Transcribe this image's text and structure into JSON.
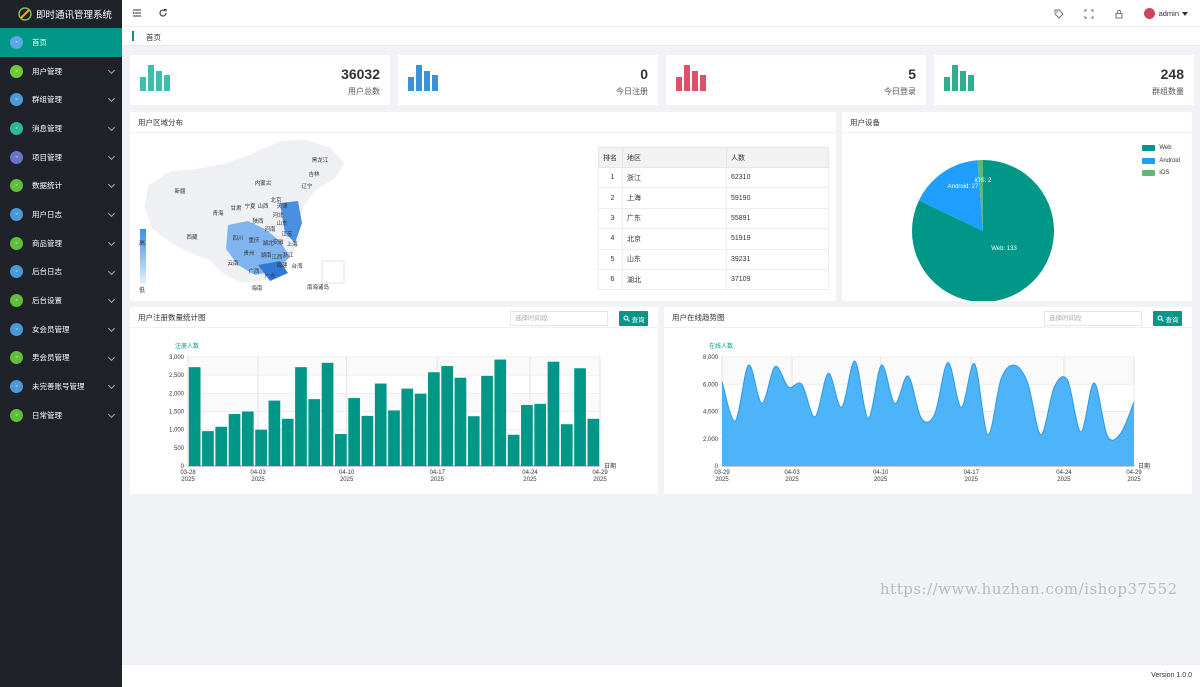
{
  "app": {
    "title": "即时通讯管理系统"
  },
  "sidebar": {
    "items": [
      {
        "label": "首页",
        "color": "#5aa9e6",
        "active": true
      },
      {
        "label": "用户管理",
        "color": "#6fca3b"
      },
      {
        "label": "群组管理",
        "color": "#4a9ad9"
      },
      {
        "label": "消息管理",
        "color": "#2fb59a"
      },
      {
        "label": "项目管理",
        "color": "#6c74c9"
      },
      {
        "label": "数据统计",
        "color": "#5fbf3a"
      },
      {
        "label": "用户日志",
        "color": "#4a9ad9"
      },
      {
        "label": "商品管理",
        "color": "#5fbf3a"
      },
      {
        "label": "后台日志",
        "color": "#4a9ad9"
      },
      {
        "label": "后台设置",
        "color": "#5fbf3a"
      },
      {
        "label": "女会员管理",
        "color": "#4a9ad9"
      },
      {
        "label": "男会员管理",
        "color": "#5fbf3a"
      },
      {
        "label": "未完善账号管理",
        "color": "#4a9ad9"
      },
      {
        "label": "日常管理",
        "color": "#5fbf3a"
      }
    ]
  },
  "topbar": {
    "user": "admin"
  },
  "breadcrumb": {
    "home": "首页"
  },
  "stats": [
    {
      "value": "36032",
      "label": "用户总数",
      "color": "#3dbfb0"
    },
    {
      "value": "0",
      "label": "今日注册",
      "color": "#3a92dd"
    },
    {
      "value": "5",
      "label": "今日登录",
      "color": "#e0506b"
    },
    {
      "value": "248",
      "label": "群组数量",
      "color": "#30b08f"
    }
  ],
  "region": {
    "title": "用户区域分布",
    "legend_high": "高",
    "legend_low": "低",
    "table_headers": [
      "排名",
      "地区",
      "人数"
    ],
    "rows": [
      [
        "1",
        "浙江",
        "62310"
      ],
      [
        "2",
        "上海",
        "59190"
      ],
      [
        "3",
        "广东",
        "55891"
      ],
      [
        "4",
        "北京",
        "51919"
      ],
      [
        "5",
        "山东",
        "39231"
      ],
      [
        "6",
        "湖北",
        "37109"
      ]
    ],
    "map_labels": [
      "黑龙江",
      "吉林",
      "辽宁",
      "内蒙古",
      "新疆",
      "青海",
      "甘肃",
      "宁夏",
      "山西",
      "北京",
      "天津",
      "河北",
      "山东",
      "陕西",
      "河南",
      "江苏",
      "安徽",
      "四川",
      "重庆",
      "湖北",
      "上海",
      "浙江",
      "西藏",
      "贵州",
      "湖南",
      "江西",
      "云南",
      "广西",
      "广东",
      "福建",
      "台湾",
      "海南",
      "南海诸岛"
    ]
  },
  "device": {
    "title": "用户设备",
    "slices": [
      {
        "name": "Web",
        "value": 133,
        "color": "#009688",
        "label": "Web: 133"
      },
      {
        "name": "Android",
        "value": 27,
        "color": "#1e9fff",
        "label": "Android: 27"
      },
      {
        "name": "iOS",
        "value": 2,
        "color": "#5fb878",
        "label": "iOS: 2"
      }
    ]
  },
  "register_chart": {
    "title": "用户注册数量统计图",
    "placeholder": "选择时间段",
    "query": "查询"
  },
  "online_chart": {
    "title": "用户在线趋势图",
    "placeholder": "选择时间段",
    "query": "查询"
  },
  "chart_data": [
    {
      "type": "bar",
      "ylabel": "注册人数",
      "xlabel": "日期",
      "ylim": [
        0,
        3000
      ],
      "yticks": [
        "3,000",
        "2,500",
        "2,000",
        "1,500",
        "1,000",
        "500",
        "0"
      ],
      "xticks": [
        [
          "03-28",
          "2025"
        ],
        [
          "04-03",
          "2025"
        ],
        [
          "04-10",
          "2025"
        ],
        [
          "04-17",
          "2025"
        ],
        [
          "04-24",
          "2025"
        ],
        [
          "04-29",
          "2025"
        ]
      ],
      "values": [
        2720,
        960,
        1080,
        1430,
        1500,
        1000,
        1800,
        1300,
        2720,
        1840,
        2840,
        880,
        1870,
        1380,
        2270,
        1530,
        2130,
        1990,
        2580,
        2750,
        2430,
        1370,
        2480,
        2930,
        860,
        1680,
        1710,
        2870,
        1150,
        2690,
        1300
      ],
      "color": "#009688"
    },
    {
      "type": "area",
      "ylabel": "在线人数",
      "xlabel": "日期",
      "ylim": [
        0,
        8000
      ],
      "yticks": [
        "8,000",
        "6,000",
        "4,000",
        "2,000",
        "0"
      ],
      "xticks": [
        [
          "03-29",
          "2025"
        ],
        [
          "04-03",
          "2025"
        ],
        [
          "04-10",
          "2025"
        ],
        [
          "04-17",
          "2025"
        ],
        [
          "04-24",
          "2025"
        ],
        [
          "04-29",
          "2025"
        ]
      ],
      "values": [
        6200,
        3300,
        7400,
        4600,
        7300,
        5800,
        6000,
        3600,
        6800,
        4300,
        7700,
        3500,
        7400,
        4600,
        6600,
        3500,
        3800,
        7600,
        4300,
        7500,
        2300,
        6400,
        7400,
        6100,
        2300,
        5800,
        6300,
        2500,
        6100,
        2200,
        2400,
        4700
      ],
      "color": "#4eb4f9"
    }
  ],
  "footer": {
    "version": "Version 1.0.0"
  },
  "watermark": "https://www.huzhan.com/ishop37552"
}
